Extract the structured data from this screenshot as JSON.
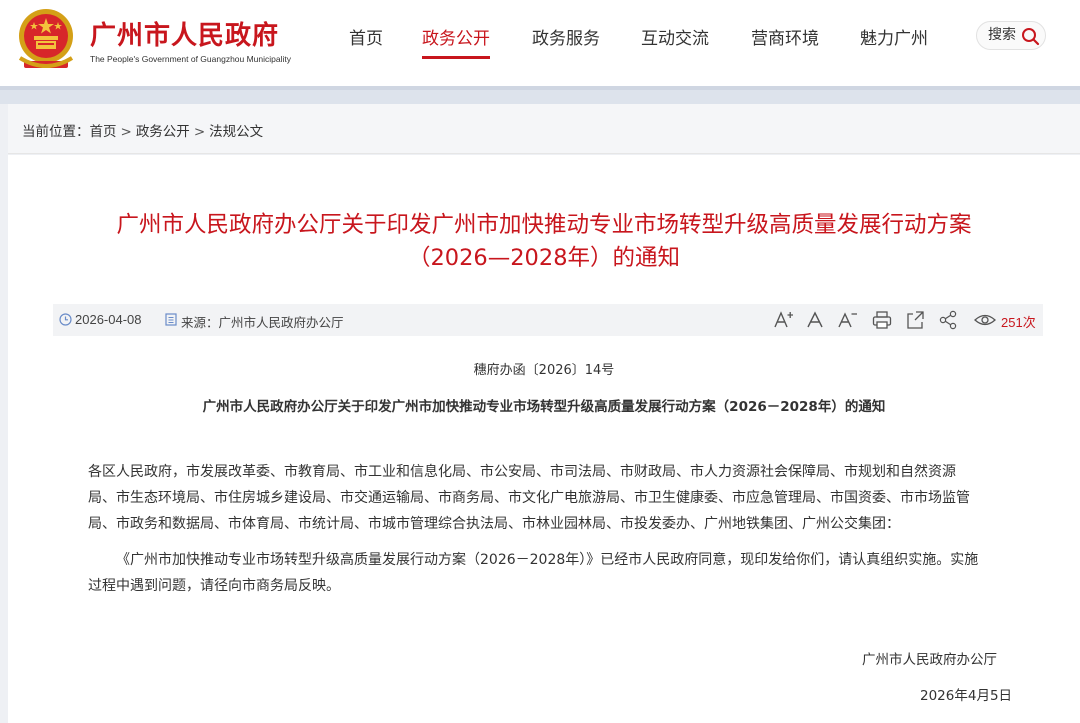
{
  "header": {
    "site_name": "广州市人民政府",
    "site_name_en": "The People's Government of Guangzhou Municipality",
    "nav": [
      {
        "label": "首页",
        "active": false
      },
      {
        "label": "政务公开",
        "active": true
      },
      {
        "label": "政务服务",
        "active": false
      },
      {
        "label": "互动交流",
        "active": false
      },
      {
        "label": "营商环境",
        "active": false
      },
      {
        "label": "魅力广州",
        "active": false
      }
    ],
    "search_label": "搜索",
    "brand_color": "#c8161d"
  },
  "breadcrumb": {
    "prefix": "当前位置：",
    "items": [
      "首页",
      "政务公开",
      "法规公文"
    ],
    "separator": ">"
  },
  "article": {
    "title_line1": "广州市人民政府办公厅关于印发广州市加快推动专业市场转型升级高质量发展行动方案",
    "title_line2": "（2026—2028年）的通知",
    "date": "2026-04-08",
    "source": "来源：广州市人民政府办公厅",
    "tools": [
      "font-increase-icon",
      "font-normal-icon",
      "font-decrease-icon",
      "print-icon",
      "share-external-icon",
      "share-icon"
    ],
    "views": "251次",
    "doc_number": "穗府办函〔2026〕14号",
    "doc_title": "广州市人民政府办公厅关于印发广州市加快推动专业市场转型升级高质量发展行动方案（2026－2028年）的通知",
    "recipients": [
      "各区人民政府，市发展改革委、市教育局、市工业和信息化局、市公安局、市司法局、市财政局、市人力资源社会保障局、市规划和自然资源",
      "局、市生态环境局、市住房城乡建设局、市交通运输局、市商务局、市文化广电旅游局、市卫生健康委、市应急管理局、市国资委、市市场监管",
      "局、市政务和数据局、市体育局、市统计局、市城市管理综合执法局、市林业园林局、市投发委办、广州地铁集团、广州公交集团："
    ],
    "body": [
      "《广州市加快推动专业市场转型升级高质量发展行动方案（2026－2028年）》已经市人民政府同意，现印发给你们，请认真组织实施。实施",
      "过程中遇到问题，请径向市商务局反映。"
    ],
    "signature": "广州市人民政府办公厅",
    "sign_date": "2026年4月5日"
  }
}
